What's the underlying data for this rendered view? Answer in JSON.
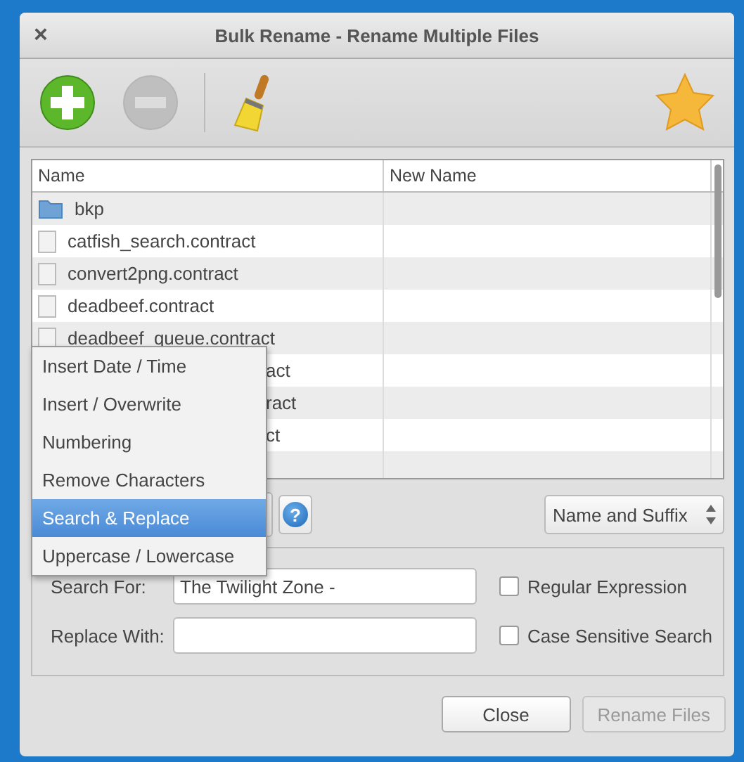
{
  "window": {
    "title": "Bulk Rename - Rename Multiple Files",
    "close": "×"
  },
  "toolbar": [
    {
      "kind": "add",
      "disabled": false
    },
    {
      "kind": "remove",
      "disabled": true
    },
    {
      "kind": "clear",
      "disabled": false
    },
    {
      "kind": "about",
      "disabled": false
    }
  ],
  "table": {
    "columns": [
      "Name",
      "New Name"
    ],
    "rows": [
      {
        "name": "bkp",
        "kind": "folder"
      },
      {
        "name": "catfish_search.contract",
        "kind": "file"
      },
      {
        "name": "convert2png.contract",
        "kind": "file"
      },
      {
        "name": "deadbeef.contract",
        "kind": "file"
      },
      {
        "name": "deadbeef_queue.contract",
        "kind": "file"
      },
      {
        "name": "act",
        "kind": "covered"
      },
      {
        "name": "ract",
        "kind": "covered"
      },
      {
        "name": "ct",
        "kind": "covered"
      },
      {
        "kind": "covered"
      }
    ]
  },
  "menu": [
    {
      "label": "Insert Date / Time",
      "selected": false
    },
    {
      "label": "Insert / Overwrite",
      "selected": false
    },
    {
      "label": "Numbering",
      "selected": false
    },
    {
      "label": "Remove Characters",
      "selected": false
    },
    {
      "label": "Search & Replace",
      "selected": true
    },
    {
      "label": "Uppercase / Lowercase",
      "selected": false
    }
  ],
  "help_button": "?",
  "name_part": "Name and Suffix",
  "fields": [
    {
      "label": "Search For:",
      "value": "The Twilight Zone -"
    },
    {
      "label": "Replace With:"
    }
  ],
  "checkboxes": [
    {
      "label": "Regular Expression",
      "checked": false
    },
    {
      "label": "Case Sensitive Search",
      "checked": false
    }
  ],
  "buttons": [
    {
      "label": "Close",
      "disabled": false
    },
    {
      "label": "Rename Files",
      "disabled": true
    }
  ]
}
